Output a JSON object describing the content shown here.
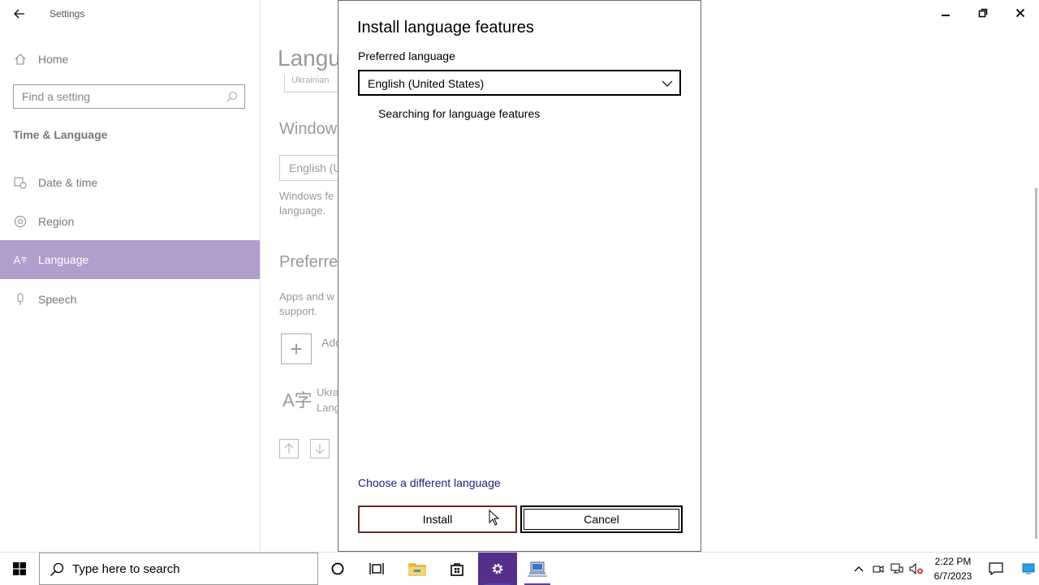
{
  "settings": {
    "window_title": "Settings",
    "home_label": "Home",
    "search_placeholder": "Find a setting",
    "section_heading": "Time & Language",
    "nav": [
      {
        "label": "Date & time"
      },
      {
        "label": "Region"
      },
      {
        "label": "Language"
      },
      {
        "label": "Speech"
      }
    ],
    "content": {
      "page_title": "Langu",
      "language_chip": "Ukrainian",
      "windows_heading": "Window",
      "display_dropdown": "English (U",
      "windows_text_1": "Windows fe",
      "windows_text_2": "language.",
      "preferred_heading": "Preferre",
      "apps_text_1": "Apps and w",
      "apps_text_2": "support.",
      "add_label": "Add",
      "lang_glyph": "A字",
      "lang_name_1": "Ukra",
      "lang_name_2": "Lang"
    }
  },
  "dialog": {
    "title": "Install language features",
    "preferred_label": "Preferred language",
    "selected_language": "English (United States)",
    "status": "Searching for language features",
    "link": "Choose a different language",
    "install_label": "Install",
    "cancel_label": "Cancel"
  },
  "taskbar": {
    "search_text": "Type here to search",
    "time": "2:22 PM",
    "date": "6/7/2023"
  },
  "colors": {
    "accent": "#b29dcc",
    "taskbar_active": "#55308a",
    "link": "#1a237e"
  }
}
